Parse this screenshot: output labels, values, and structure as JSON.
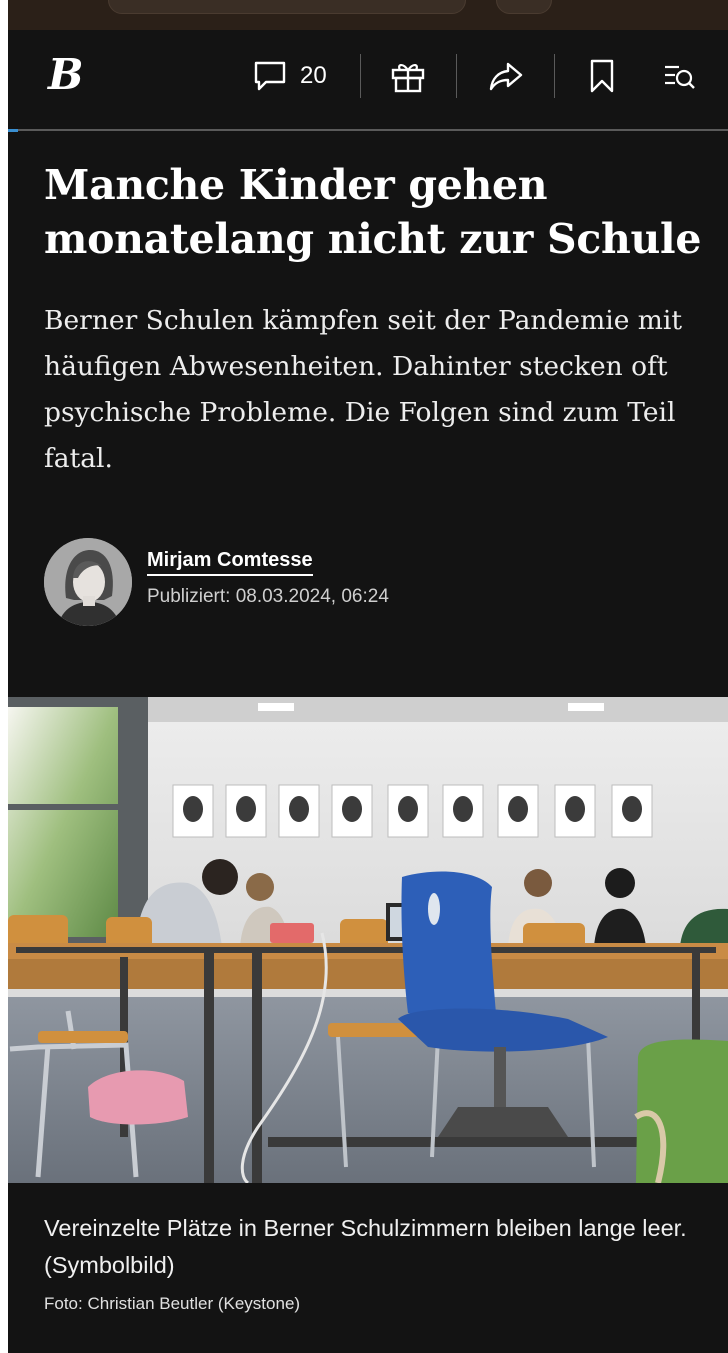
{
  "header": {
    "logo_text": "B",
    "comment_count": "20",
    "icons": [
      "comment-icon",
      "gift-icon",
      "share-icon",
      "bookmark-icon",
      "search-menu-icon"
    ],
    "reading_progress": 0.01
  },
  "article": {
    "headline": "Manche Kinder gehen monatelang nicht zur Schule",
    "lead": "Berner Schulen kämpfen seit der Pandemie mit häufigen Abwesenheiten. Dahinter stecken oft psychische Probleme. Die Folgen sind zum Teil fatal.",
    "author": "Mirjam Comtesse",
    "published": "Publiziert: 08.03.2024, 06:24"
  },
  "image": {
    "caption": "Vereinzelte Plätze in Berner Schulzimmern bleiben lange leer. (Symbolbild)",
    "credit": "Foto: Christian Beutler (Keystone)"
  },
  "colors": {
    "background": "#131313",
    "accent": "#3a8fd1",
    "chair": "#2d5fb8"
  }
}
